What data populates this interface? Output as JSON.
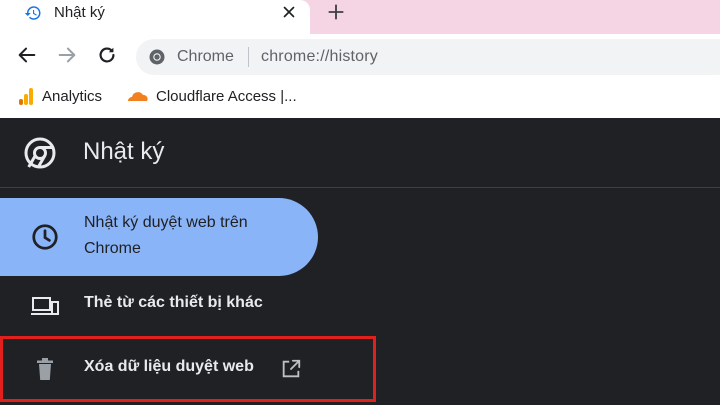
{
  "tab": {
    "title": "Nhật ký",
    "favicon": "history-icon",
    "close_icon": "close-icon"
  },
  "tabstrip": {
    "new_tab_icon": "plus-icon"
  },
  "toolbar": {
    "back_icon": "arrow-left-icon",
    "forward_icon": "arrow-right-icon",
    "reload_icon": "reload-icon",
    "omnibox": {
      "chip_label": "Chrome",
      "url": "chrome://history",
      "site_icon": "chrome-icon"
    }
  },
  "bookmarks": [
    {
      "label": "Analytics",
      "icon": "analytics-bars-icon"
    },
    {
      "label": "Cloudflare Access |...",
      "icon": "cloudflare-icon"
    }
  ],
  "page": {
    "title": "Nhật ký",
    "logo": "chrome-logo-icon",
    "nav": [
      {
        "label": "Nhật ký duyệt web trên Chrome",
        "icon": "clock-icon",
        "active": true
      },
      {
        "label": "Thẻ từ các thiết bị khác",
        "icon": "devices-icon",
        "active": false
      },
      {
        "label": "Xóa dữ liệu duyệt web",
        "icon": "trash-icon",
        "trailing_icon": "open-in-new-icon",
        "highlighted": true
      }
    ]
  },
  "colors": {
    "tabstrip_bg": "#f5d5e3",
    "page_bg": "#202124",
    "active_nav_bg": "#8ab4f8",
    "highlight_border": "#e0201c",
    "text_light": "#e8eaed"
  }
}
